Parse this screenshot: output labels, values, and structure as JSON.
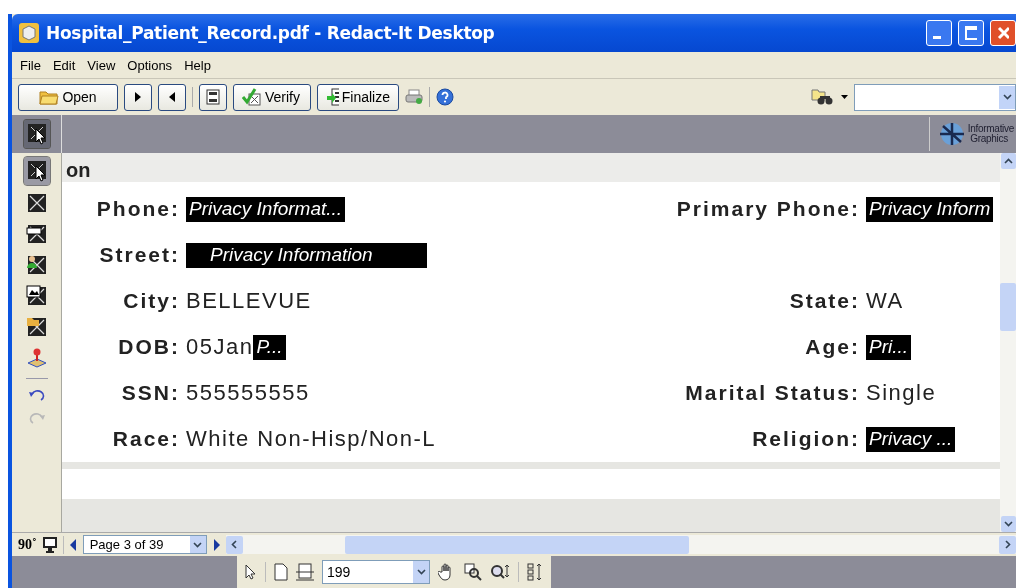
{
  "window": {
    "title": "Hospital_Patient_Record.pdf - Redact-It Desktop"
  },
  "menu": [
    "File",
    "Edit",
    "View",
    "Options",
    "Help"
  ],
  "toolbar": {
    "open": "Open",
    "verify": "Verify",
    "finalize": "Finalize"
  },
  "brand": {
    "line1": "Informative",
    "line2": "Graphics"
  },
  "band_tool": {
    "selected": true
  },
  "tools": [
    {
      "kind": "select",
      "selected": true
    },
    {
      "kind": "redact-area",
      "selected": false
    },
    {
      "kind": "redact-banner",
      "selected": false
    },
    {
      "kind": "redact-person",
      "selected": false
    },
    {
      "kind": "redact-picture",
      "selected": false
    },
    {
      "kind": "redact-folder",
      "selected": false
    },
    {
      "kind": "stamp",
      "selected": false
    },
    {
      "kind": "separator"
    },
    {
      "kind": "undo",
      "disabled": false
    },
    {
      "kind": "redo",
      "disabled": true
    }
  ],
  "document": {
    "section_title": "on",
    "rows": [
      {
        "left": {
          "label": "Phone:",
          "value": [
            {
              "kind": "redacted",
              "text": "Privacy Informat..."
            }
          ]
        },
        "right": {
          "label": "Primary Phone:",
          "value": [
            {
              "kind": "redacted",
              "text": "Privacy Inform"
            }
          ]
        }
      },
      {
        "left": {
          "label": "Street:",
          "value": [
            {
              "kind": "redacted-wide",
              "text": "Privacy Information"
            }
          ]
        }
      },
      {
        "left": {
          "label": "City:",
          "value": [
            {
              "kind": "text",
              "text": "BELLEVUE"
            }
          ]
        },
        "right": {
          "label": "State:",
          "value": [
            {
              "kind": "text",
              "text": "WA"
            }
          ]
        }
      },
      {
        "left": {
          "label": "DOB:",
          "value": [
            {
              "kind": "text",
              "text": "05Jan"
            },
            {
              "kind": "redacted",
              "text": "P..."
            }
          ]
        },
        "right": {
          "label": "Age:",
          "value": [
            {
              "kind": "redacted",
              "text": "Pri..."
            }
          ]
        }
      },
      {
        "left": {
          "label": "SSN:",
          "value": [
            {
              "kind": "text",
              "text": "555555555"
            }
          ]
        },
        "right": {
          "label": "Marital Status:",
          "value": [
            {
              "kind": "text",
              "text": "Single"
            }
          ]
        }
      },
      {
        "left": {
          "label": "Race:",
          "value": [
            {
              "kind": "text",
              "text": "White Non-Hisp/Non-L"
            }
          ]
        },
        "right": {
          "label": "Religion:",
          "value": [
            {
              "kind": "redacted",
              "text": "Privacy ..."
            }
          ]
        }
      }
    ]
  },
  "navigation": {
    "rotation": "90˚",
    "page": "Page 3 of 39"
  },
  "view_toolbar": {
    "zoom": "199"
  }
}
